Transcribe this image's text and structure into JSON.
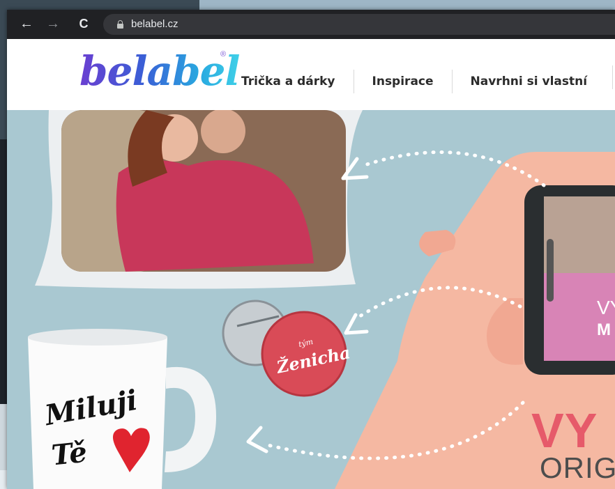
{
  "browser": {
    "url": "belabel.cz",
    "nav": {
      "back": "←",
      "forward": "→",
      "reload": "C"
    }
  },
  "site": {
    "logo": "belabel",
    "logo_mark": "®",
    "menu": [
      {
        "label": "Trička a dárky"
      },
      {
        "label": "Inspirace"
      },
      {
        "label": "Navrhni si vlastní"
      }
    ]
  },
  "hero": {
    "mug_text_line1": "Miluji",
    "mug_text_line2": "Tě",
    "badge_text_small": "tým",
    "badge_text_big": "Ženicha",
    "phone_text_line1": "VY",
    "phone_text_line2": "M",
    "headline": "VY",
    "subheadline": "ORIG"
  },
  "colors": {
    "hero_bg": "#a9c8d1",
    "headline": "#e65a6a",
    "phone_screen": "#d884b6",
    "badge": "#d94b57",
    "heart": "#e0242f",
    "skin": "#f5b8a2"
  }
}
